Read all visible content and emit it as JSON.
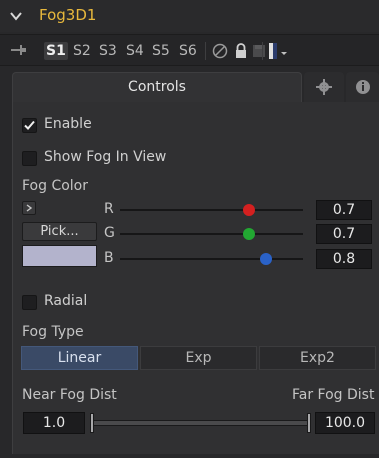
{
  "node": {
    "title": "Fog3D1"
  },
  "versions": [
    "S1",
    "S2",
    "S3",
    "S4",
    "S5",
    "S6"
  ],
  "tabs": {
    "controls": "Controls"
  },
  "enable": {
    "label": "Enable",
    "checked": true
  },
  "show_fog": {
    "label": "Show Fog In View",
    "checked": false
  },
  "fog_color": {
    "label": "Fog Color",
    "pick_label": "Pick...",
    "swatch": "#b3b3cc",
    "channels": [
      {
        "label": "R",
        "value": "0.7",
        "knob_color": "#d42020"
      },
      {
        "label": "G",
        "value": "0.7",
        "knob_color": "#22a832"
      },
      {
        "label": "B",
        "value": "0.8",
        "knob_color": "#2a62c8"
      }
    ]
  },
  "radial": {
    "label": "Radial",
    "checked": false
  },
  "fog_type": {
    "label": "Fog Type",
    "options": [
      "Linear",
      "Exp",
      "Exp2"
    ],
    "selected": "Linear"
  },
  "distance": {
    "near_label": "Near Fog Dist",
    "far_label": "Far Fog Dist",
    "near_value": "1.0",
    "far_value": "100.0"
  },
  "colors": {
    "title": "#e8b83c",
    "accent": "#3a4a66"
  }
}
